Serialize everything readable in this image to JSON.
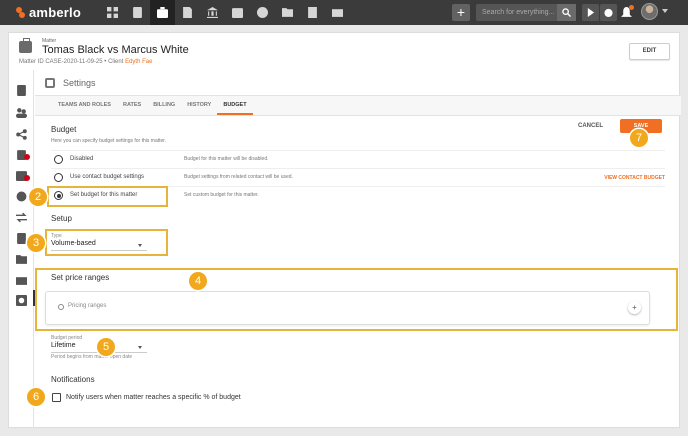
{
  "app": {
    "name": "amberlo",
    "brand_color": "#f06f23"
  },
  "topbar": {
    "nav_icons": [
      "dashboard-icon",
      "contacts-icon",
      "matters-icon",
      "documents-icon",
      "billing-icon",
      "calendar-icon",
      "time-icon",
      "folder-icon",
      "forms-icon",
      "mail-icon"
    ],
    "active_nav": "matters-icon",
    "search_placeholder": "Search for everything...",
    "add_label": "+"
  },
  "header": {
    "tag": "Matter",
    "title": "Tomas Black vs Marcus White",
    "matter_id_label": "Matter ID",
    "matter_id": "CASE-2020-11-09-25",
    "separator": "•",
    "client_label": "Client",
    "client_name": "Edyth Fae",
    "edit_label": "EDIT"
  },
  "left_rail": [
    "book-icon",
    "team-icon",
    "share-icon",
    "tasks-icon",
    "events-icon",
    "time-icon",
    "transfer-icon",
    "invoice-icon",
    "folder-icon",
    "mail-icon",
    "settings-icon"
  ],
  "settings": {
    "title": "Settings",
    "tabs": [
      "TEAMS AND ROLES",
      "RATES",
      "BILLING",
      "HISTORY",
      "BUDGET"
    ],
    "active_tab": "BUDGET"
  },
  "budget": {
    "title": "Budget",
    "description": "Here you can specify budget settings for this matter.",
    "cancel_label": "CANCEL",
    "save_label": "SAVE",
    "options": [
      {
        "label": "Disabled",
        "description": "Budget for this matter will be disabled.",
        "selected": false
      },
      {
        "label": "Use contact budget settings",
        "description": "Budget settings from related contact will be used.",
        "selected": false,
        "link": "VIEW CONTACT BUDGET"
      },
      {
        "label": "Set budget for this matter",
        "description": "Set custom budget for this matter.",
        "selected": true
      }
    ]
  },
  "setup": {
    "title": "Setup",
    "type_label": "Type",
    "type_value": "Volume-based"
  },
  "price_ranges": {
    "title": "Set price ranges",
    "placeholder": "Pricing ranges",
    "add_label": "+"
  },
  "period": {
    "label": "Budget period",
    "value": "Lifetime",
    "hint": "Period begins from matter open date"
  },
  "notifications": {
    "title": "Notifications",
    "checkbox_label": "Notify users when matter reaches a specific % of budget",
    "checked": false
  },
  "tutorial": {
    "highlight_color": "#e6b43a",
    "badge_color": "#f2a81d",
    "steps": [
      "2",
      "3",
      "4",
      "5",
      "6",
      "7"
    ]
  }
}
